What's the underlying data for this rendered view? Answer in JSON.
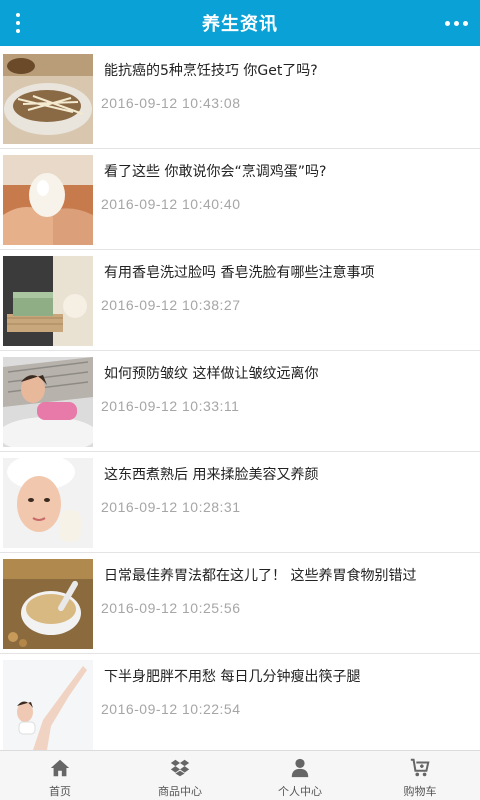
{
  "header": {
    "title": "养生资讯",
    "menu_icon": "vertical-dots-icon",
    "more_icon": "horizontal-dots-icon"
  },
  "articles": [
    {
      "title": "能抗癌的5种烹饪技巧 你Get了吗?",
      "time": "2016-09-12 10:43:08"
    },
    {
      "title": "看了这些 你敢说你会“烹调鸡蛋”吗?",
      "time": "2016-09-12 10:40:40"
    },
    {
      "title": "有用香皂洗过脸吗 香皂洗脸有哪些注意事项",
      "time": "2016-09-12 10:38:27"
    },
    {
      "title": "如何预防皱纹 这样做让皱纹远离你",
      "time": "2016-09-12 10:33:11"
    },
    {
      "title": "这东西煮熟后 用来揉脸美容又养颜",
      "time": "2016-09-12 10:28:31"
    },
    {
      "title": "日常最佳养胃法都在这儿了！ 这些养胃食物别错过",
      "time": "2016-09-12 10:25:56"
    },
    {
      "title": "下半身肥胖不用愁 每日几分钟瘦出筷子腿",
      "time": "2016-09-12 10:22:54"
    }
  ],
  "nav": [
    {
      "label": "首页",
      "icon": "home-icon"
    },
    {
      "label": "商品中心",
      "icon": "dropbox-icon"
    },
    {
      "label": "个人中心",
      "icon": "user-icon"
    },
    {
      "label": "购物车",
      "icon": "cart-icon"
    }
  ],
  "colors": {
    "header_bg": "#0aa1d6",
    "time_text": "#a6a6a6",
    "nav_bg": "#f6f6f6",
    "nav_icon": "#666666"
  }
}
